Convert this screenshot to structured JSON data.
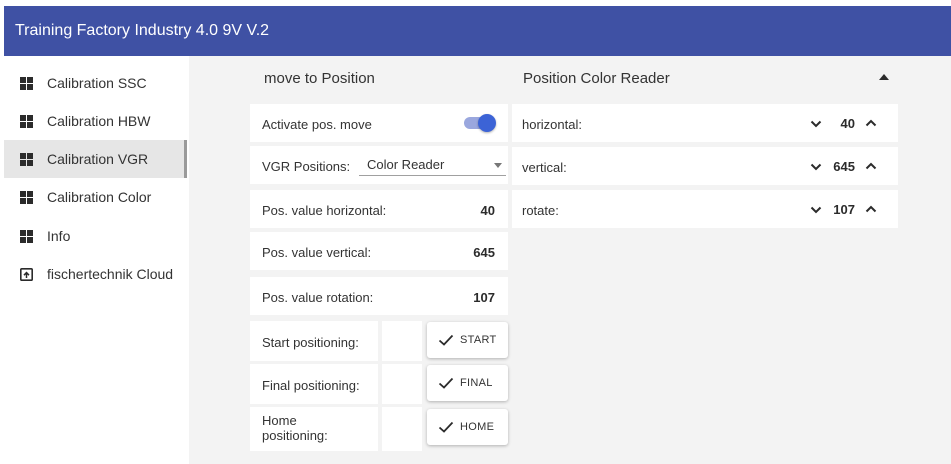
{
  "app": {
    "title": "Training Factory Industry 4.0 9V V.2"
  },
  "sidebar": {
    "items": [
      {
        "label": "Calibration SSC",
        "icon": "grid-icon",
        "active": false
      },
      {
        "label": "Calibration HBW",
        "icon": "grid-icon",
        "active": false
      },
      {
        "label": "Calibration VGR",
        "icon": "grid-icon",
        "active": true
      },
      {
        "label": "Calibration Color",
        "icon": "grid-icon",
        "active": false
      },
      {
        "label": "Info",
        "icon": "grid-icon",
        "active": false
      },
      {
        "label": "fischertechnik Cloud",
        "icon": "cloud-upload-icon",
        "active": false
      }
    ]
  },
  "move": {
    "title": "move to Position",
    "activate_label": "Activate pos. move",
    "activate_on": true,
    "positions_label": "VGR Positions:",
    "positions_value": "Color Reader",
    "horizontal_label": "Pos. value horizontal:",
    "horizontal_value": "40",
    "vertical_label": "Pos. value vertical:",
    "vertical_value": "645",
    "rotation_label": "Pos. value rotation:",
    "rotation_value": "107",
    "start_label": "Start positioning:",
    "start_button": "START",
    "final_label": "Final positioning:",
    "final_button": "FINAL",
    "home_label_1": "Home",
    "home_label_2": "positioning:",
    "home_button": "HOME"
  },
  "color_reader": {
    "title": "Position Color Reader",
    "rows": [
      {
        "label": "horizontal:",
        "value": "40"
      },
      {
        "label": "vertical:",
        "value": "645"
      },
      {
        "label": "rotate:",
        "value": "107"
      }
    ]
  },
  "colors": {
    "header": "#3f51a4",
    "accent": "#3c63d6",
    "background": "#f3f3f3"
  }
}
